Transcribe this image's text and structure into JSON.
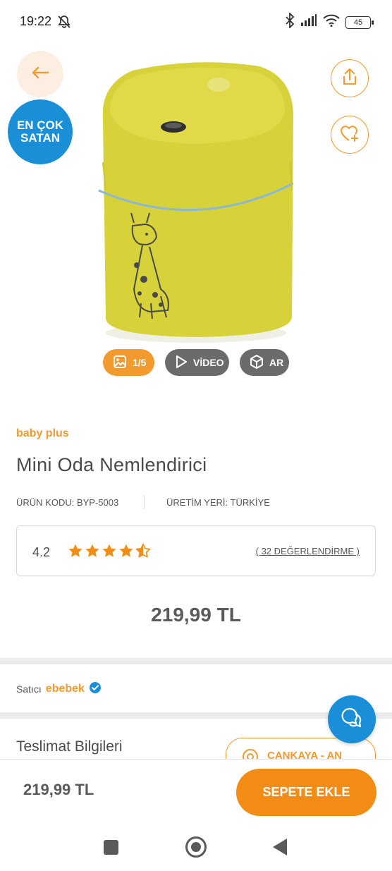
{
  "status_bar": {
    "time": "19:22",
    "battery": "45"
  },
  "hero": {
    "badge_line1": "EN ÇOK",
    "badge_line2": "SATAN",
    "media": {
      "photo_counter": "1/5",
      "video_label": "VİDEO",
      "ar_label": "AR"
    }
  },
  "product": {
    "brand": "baby plus",
    "title": "Mini Oda Nemlendirici",
    "code": "ÜRÜN KODU: BYP-5003",
    "origin": "ÜRETİM YERİ: TÜRKİYE",
    "rating": {
      "score": "4.2",
      "stars_value": 4.5,
      "count_label": "( 32 DEĞERLENDİRME )"
    },
    "price": "219,99 TL"
  },
  "seller": {
    "label": "Satıcı",
    "name": "ebebek"
  },
  "delivery": {
    "title": "Teslimat Bilgileri",
    "location_label": "ÇANKAYA - AN"
  },
  "bottom_bar": {
    "price": "219,99 TL",
    "add_to_cart_label": "SEPETE EKLE"
  },
  "colors": {
    "accent": "#f29a2e",
    "cart_button": "#f28c14",
    "blue": "#1a8fd8",
    "product_yellow": "#d7d13a"
  },
  "icons": [
    "back-arrow-icon",
    "share-icon",
    "heart-plus-icon",
    "image-icon",
    "play-icon",
    "ar-cube-icon",
    "star-icon",
    "verified-icon",
    "location-pin-icon",
    "chat-icon"
  ]
}
